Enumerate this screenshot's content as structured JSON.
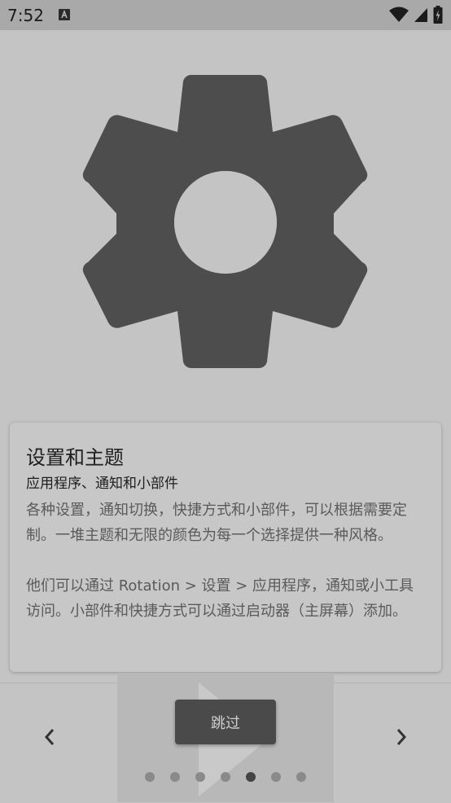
{
  "status_bar": {
    "time": "7:52"
  },
  "card": {
    "title": "设置和主题",
    "subtitle": "应用程序、通知和小部件",
    "paragraph1": "各种设置，通知切换，快捷方式和小部件，可以根据需要定制。一堆主题和无限的颜色为每一个选择提供一种风格。",
    "paragraph2": "他们可以通过 Rotation > 设置 > 应用程序，通知或小工具访问。小部件和快捷方式可以通过启动器（主屏幕）添加。"
  },
  "skip_label": "跳过",
  "pager": {
    "total": 7,
    "active_index": 4
  },
  "colors": {
    "gear": "#4d4d4d",
    "button": "#4a4a4a",
    "background": "#c4c4c4"
  },
  "icons": {
    "hero": "gear-icon",
    "prev": "chevron-left-icon",
    "next": "chevron-right-icon"
  }
}
